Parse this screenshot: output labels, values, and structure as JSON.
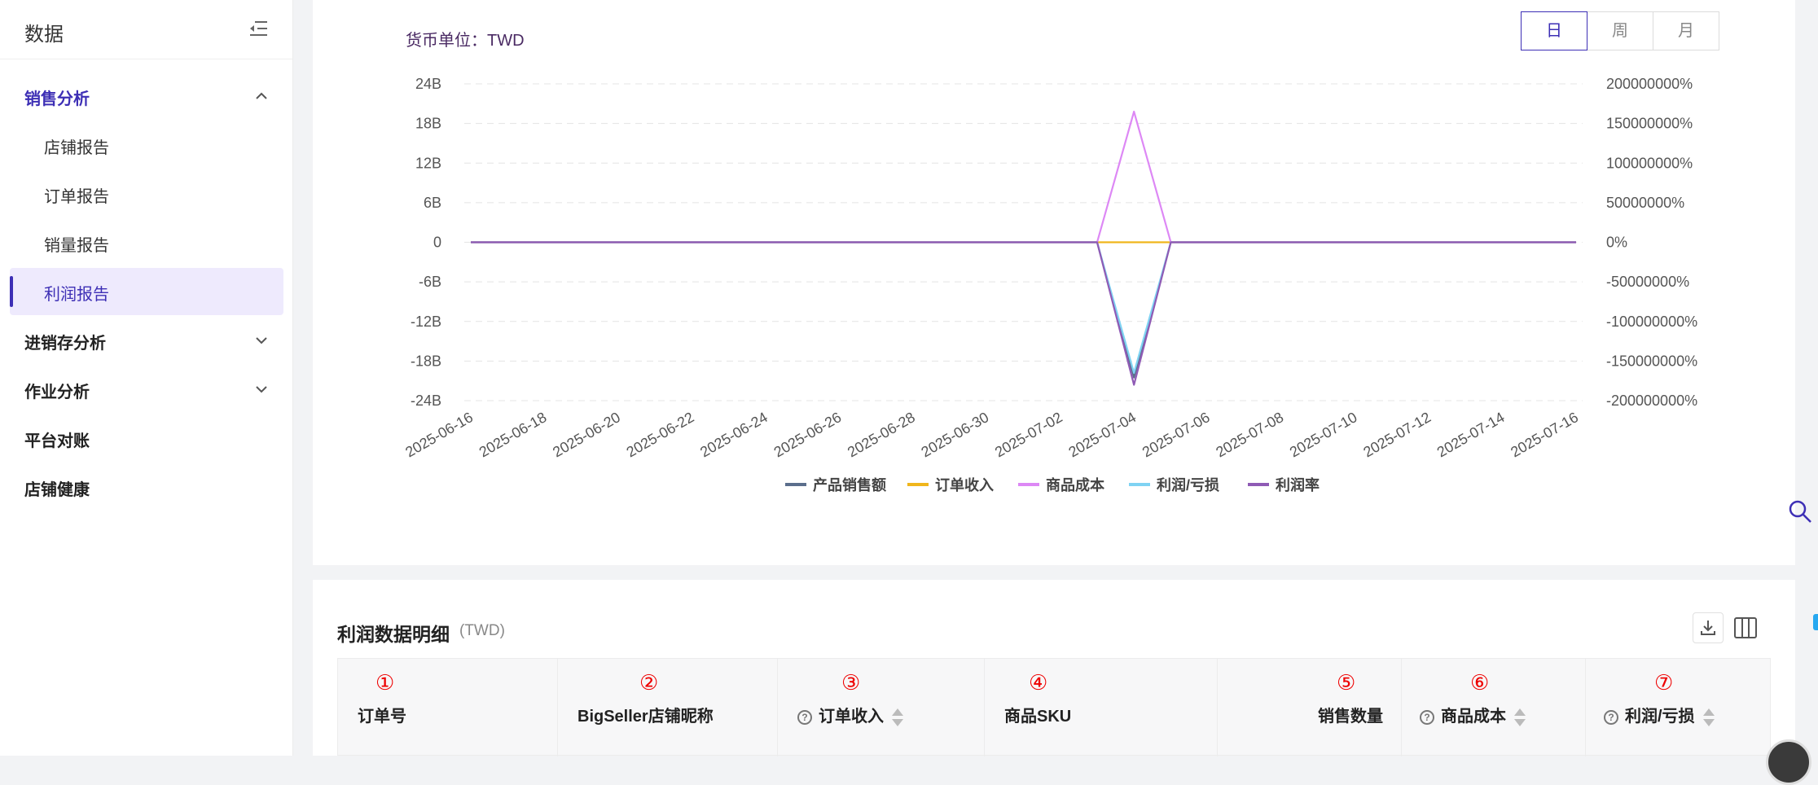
{
  "sidebar": {
    "title": "数据",
    "items": [
      {
        "label": "销售分析",
        "expanded": true
      },
      {
        "label": "店铺报告"
      },
      {
        "label": "订单报告"
      },
      {
        "label": "销量报告"
      },
      {
        "label": "利润报告",
        "selected": true
      },
      {
        "label": "进销存分析"
      },
      {
        "label": "作业分析"
      },
      {
        "label": "平台对账"
      },
      {
        "label": "店铺健康"
      }
    ]
  },
  "chart_header": {
    "currency_label": "货币单位：TWD",
    "period_tabs": [
      "日",
      "周",
      "月"
    ],
    "active_tab": "日"
  },
  "chart_data": {
    "type": "line",
    "x": [
      "2025-06-16",
      "2025-06-17",
      "2025-06-18",
      "2025-06-19",
      "2025-06-20",
      "2025-06-21",
      "2025-06-22",
      "2025-06-23",
      "2025-06-24",
      "2025-06-25",
      "2025-06-26",
      "2025-06-27",
      "2025-06-28",
      "2025-06-29",
      "2025-06-30",
      "2025-07-01",
      "2025-07-02",
      "2025-07-03",
      "2025-07-04",
      "2025-07-05",
      "2025-07-06",
      "2025-07-07",
      "2025-07-08",
      "2025-07-09",
      "2025-07-10",
      "2025-07-11",
      "2025-07-12",
      "2025-07-13",
      "2025-07-14",
      "2025-07-15",
      "2025-07-16"
    ],
    "x_tick_labels": [
      "2025-06-16",
      "2025-06-18",
      "2025-06-20",
      "2025-06-22",
      "2025-06-24",
      "2025-06-26",
      "2025-06-28",
      "2025-06-30",
      "2025-07-02",
      "2025-07-04",
      "2025-07-06",
      "2025-07-08",
      "2025-07-10",
      "2025-07-12",
      "2025-07-14",
      "2025-07-16"
    ],
    "y_left": {
      "ylim": [
        -24000000000,
        24000000000
      ],
      "ticks": [
        "24B",
        "18B",
        "12B",
        "6B",
        "0",
        "-6B",
        "-12B",
        "-18B",
        "-24B"
      ]
    },
    "y_right": {
      "ylim": [
        -200000000,
        200000000
      ],
      "ticks": [
        "200000000%",
        "150000000%",
        "100000000%",
        "50000000%",
        "0%",
        "-50000000%",
        "-100000000%",
        "-150000000%",
        "-200000000%"
      ]
    },
    "grid": true,
    "legend_position": "bottom",
    "series": [
      {
        "name": "产品销售额",
        "color": "#5b6e8c",
        "axis": "left",
        "spike": {
          "x": "2025-07-04",
          "value": -20500000000
        }
      },
      {
        "name": "订单收入",
        "color": "#f0b61c",
        "axis": "left",
        "spike": {
          "x": "2025-07-04",
          "value": 0
        }
      },
      {
        "name": "商品成本",
        "color": "#dd88f5",
        "axis": "left",
        "spike": {
          "x": "2025-07-04",
          "value": 19800000000
        }
      },
      {
        "name": "利润/亏损",
        "color": "#7fd3f3",
        "axis": "left",
        "spike": {
          "x": "2025-07-04",
          "value": -19800000000
        }
      },
      {
        "name": "利润率",
        "color": "#8f5bb5",
        "axis": "right",
        "spike": {
          "x": "2025-07-04",
          "value": -180000000
        }
      }
    ]
  },
  "table": {
    "title": "利润数据明细",
    "unit": "(TWD)",
    "columns": [
      {
        "marker": "①",
        "label": "订单号"
      },
      {
        "marker": "②",
        "label": "BigSeller店铺昵称"
      },
      {
        "marker": "③",
        "label": "订单收入",
        "help": "?",
        "sortable": true
      },
      {
        "marker": "④",
        "label": "商品SKU"
      },
      {
        "marker": "⑤",
        "label": "销售数量"
      },
      {
        "marker": "⑥",
        "label": "商品成本",
        "help": "?",
        "sortable": true
      },
      {
        "marker": "⑦",
        "label": "利润/亏损",
        "help": "?",
        "sortable": true
      }
    ]
  },
  "icons": {
    "collapse": "menu-collapse-icon",
    "download": "download-icon",
    "columns": "columns-icon",
    "search": "search-icon"
  }
}
